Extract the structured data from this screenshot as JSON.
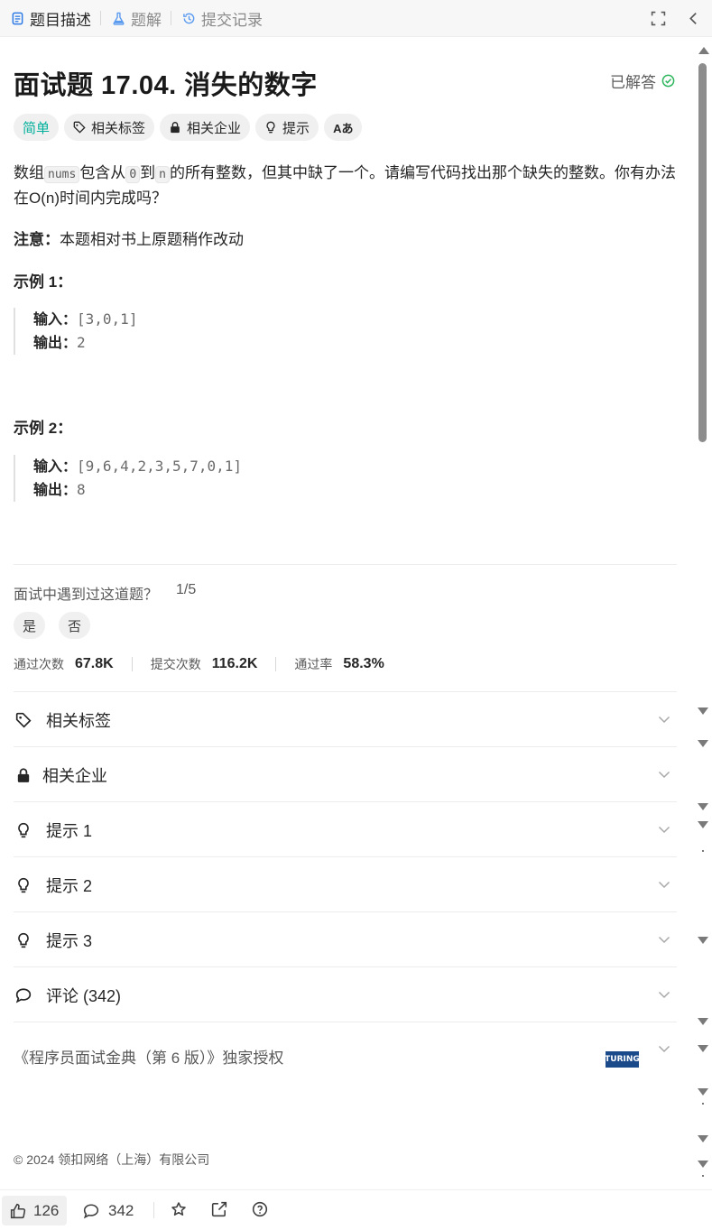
{
  "tabs": [
    {
      "label": "题目描述",
      "icon": "description-icon",
      "active": true
    },
    {
      "label": "题解",
      "icon": "flask-icon",
      "active": false
    },
    {
      "label": "提交记录",
      "icon": "history-icon",
      "active": false
    }
  ],
  "problem": {
    "title": "面试题 17.04. 消失的数字",
    "status": "已解答",
    "chips": {
      "difficulty": "简单",
      "tags": "相关标签",
      "companies": "相关企业",
      "hint": "提示",
      "translate": "Aあ"
    },
    "desc_part1": "数组",
    "desc_code1": "nums",
    "desc_part2": "包含从",
    "desc_code2": "0",
    "desc_part3": "到",
    "desc_code3": "n",
    "desc_part4": "的所有整数，但其中缺了一个。请编写代码找出那个缺失的整数。你有办法在O(n)时间内完成吗？",
    "note_label": "注意：",
    "note_text": "本题相对书上原题稍作改动",
    "examples": [
      {
        "title": "示例 1：",
        "input_label": "输入：",
        "input": "[3,0,1]",
        "output_label": "输出：",
        "output": "2"
      },
      {
        "title": "示例 2：",
        "input_label": "输入：",
        "input": "[9,6,4,2,3,5,7,0,1]",
        "output_label": "输出：",
        "output": "8"
      }
    ]
  },
  "interview": {
    "question": "面试中遇到过这道题？",
    "progress": "1/5",
    "yes": "是",
    "no": "否"
  },
  "stats": {
    "accepted_label": "通过次数",
    "accepted": "67.8K",
    "submissions_label": "提交次数",
    "submissions": "116.2K",
    "rate_label": "通过率",
    "rate": "58.3%"
  },
  "accordion": [
    {
      "label": "相关标签",
      "icon": "tag-icon"
    },
    {
      "label": "相关企业",
      "icon": "lock-icon"
    },
    {
      "label": "提示 1",
      "icon": "lightbulb-icon"
    },
    {
      "label": "提示 2",
      "icon": "lightbulb-icon"
    },
    {
      "label": "提示 3",
      "icon": "lightbulb-icon"
    },
    {
      "label": "评论 (342)",
      "icon": "comment-icon"
    }
  ],
  "source": {
    "text": "《程序员面试金典（第 6 版）》独家授权",
    "logo_text": "TURING"
  },
  "footer": {
    "copyright": "© 2024 领扣网络（上海）有限公司"
  },
  "bottombar": {
    "likes": "126",
    "comments": "342"
  },
  "colors": {
    "easy": "#00af9b",
    "solved": "#2db55d",
    "accent": "#1b4a8b"
  }
}
